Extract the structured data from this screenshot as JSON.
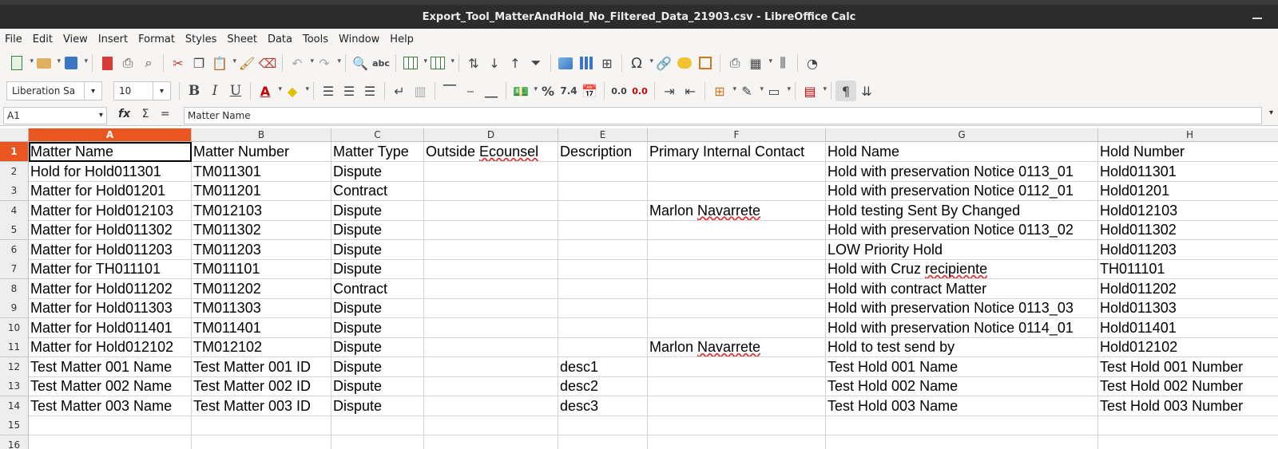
{
  "window": {
    "title": "Export_Tool_MatterAndHold_No_Filtered_Data_21903.csv - LibreOffice Calc"
  },
  "menu": [
    "File",
    "Edit",
    "View",
    "Insert",
    "Format",
    "Styles",
    "Sheet",
    "Data",
    "Tools",
    "Window",
    "Help"
  ],
  "format_toolbar": {
    "font_name": "Liberation Sa",
    "font_size": "10",
    "bold": "B",
    "italic": "I",
    "underline": "U",
    "percent": "%",
    "number": "7.4",
    "decimal_add": "0.0",
    "decimal_remove": "0.0"
  },
  "formula_bar": {
    "name_box": "A1",
    "fx": "fx",
    "sigma": "Σ",
    "equals": "=",
    "content": "Matter Name"
  },
  "sheet": {
    "columns": [
      "A",
      "B",
      "C",
      "D",
      "E",
      "F",
      "G",
      "H"
    ],
    "row_numbers": [
      "1",
      "2",
      "3",
      "4",
      "5",
      "6",
      "7",
      "8",
      "9",
      "10",
      "11",
      "12",
      "13",
      "14",
      "15",
      "16"
    ],
    "rows": [
      [
        "Matter Name",
        "Matter Number",
        "Matter Type",
        "Outside Ecounsel",
        "Description",
        "Primary Internal Contact",
        "Hold Name",
        "Hold Number"
      ],
      [
        "Hold for Hold011301",
        "TM011301",
        "Dispute",
        "",
        "",
        "",
        "Hold with preservation Notice 0113_01",
        "Hold011301"
      ],
      [
        "Matter for Hold01201",
        "TM011201",
        "Contract",
        "",
        "",
        "",
        "Hold with preservation Notice 0112_01",
        "Hold01201"
      ],
      [
        "Matter for Hold012103",
        "TM012103",
        "Dispute",
        "",
        "",
        "Marlon Navarrete",
        "Hold testing Sent By Changed",
        "Hold012103"
      ],
      [
        "Matter for Hold011302",
        "TM011302",
        "Dispute",
        "",
        "",
        "",
        "Hold with preservation Notice 0113_02",
        "Hold011302"
      ],
      [
        "Matter for Hold011203",
        "TM011203",
        "Dispute",
        "",
        "",
        "",
        "LOW Priority Hold",
        "Hold011203"
      ],
      [
        "Matter for TH011101",
        "TM011101",
        "Dispute",
        "",
        "",
        "",
        "Hold with Cruz recipiente",
        "TH011101"
      ],
      [
        "Matter for Hold011202",
        "TM011202",
        "Contract",
        "",
        "",
        "",
        "Hold with contract Matter",
        "Hold011202"
      ],
      [
        "Matter for Hold011303",
        "TM011303",
        "Dispute",
        "",
        "",
        "",
        "Hold with preservation Notice 0113_03",
        "Hold011303"
      ],
      [
        "Matter for Hold011401",
        "TM011401",
        "Dispute",
        "",
        "",
        "",
        "Hold with preservation Notice 0114_01",
        "Hold011401"
      ],
      [
        "Matter for Hold012102",
        "TM012102",
        "Dispute",
        "",
        "",
        "Marlon Navarrete",
        "Hold to test send by",
        "Hold012102"
      ],
      [
        "Test Matter 001 Name",
        "Test Matter 001 ID",
        "Dispute",
        "",
        "desc1",
        "",
        "Test Hold 001 Name",
        "Test Hold 001 Number"
      ],
      [
        "Test Matter 002 Name",
        "Test Matter 002 ID",
        "Dispute",
        "",
        "desc2",
        "",
        "Test Hold 002 Name",
        "Test Hold 002 Number"
      ],
      [
        "Test Matter 003 Name",
        "Test Matter 003 ID",
        "Dispute",
        "",
        "desc3",
        "",
        "Test Hold 003 Name",
        "Test Hold 003 Number"
      ],
      [
        "",
        "",
        "",
        "",
        "",
        "",
        "",
        ""
      ],
      [
        "",
        "",
        "",
        "",
        "",
        "",
        "",
        ""
      ]
    ],
    "selected_cell": "A1",
    "accent_color": "#e9561f"
  }
}
